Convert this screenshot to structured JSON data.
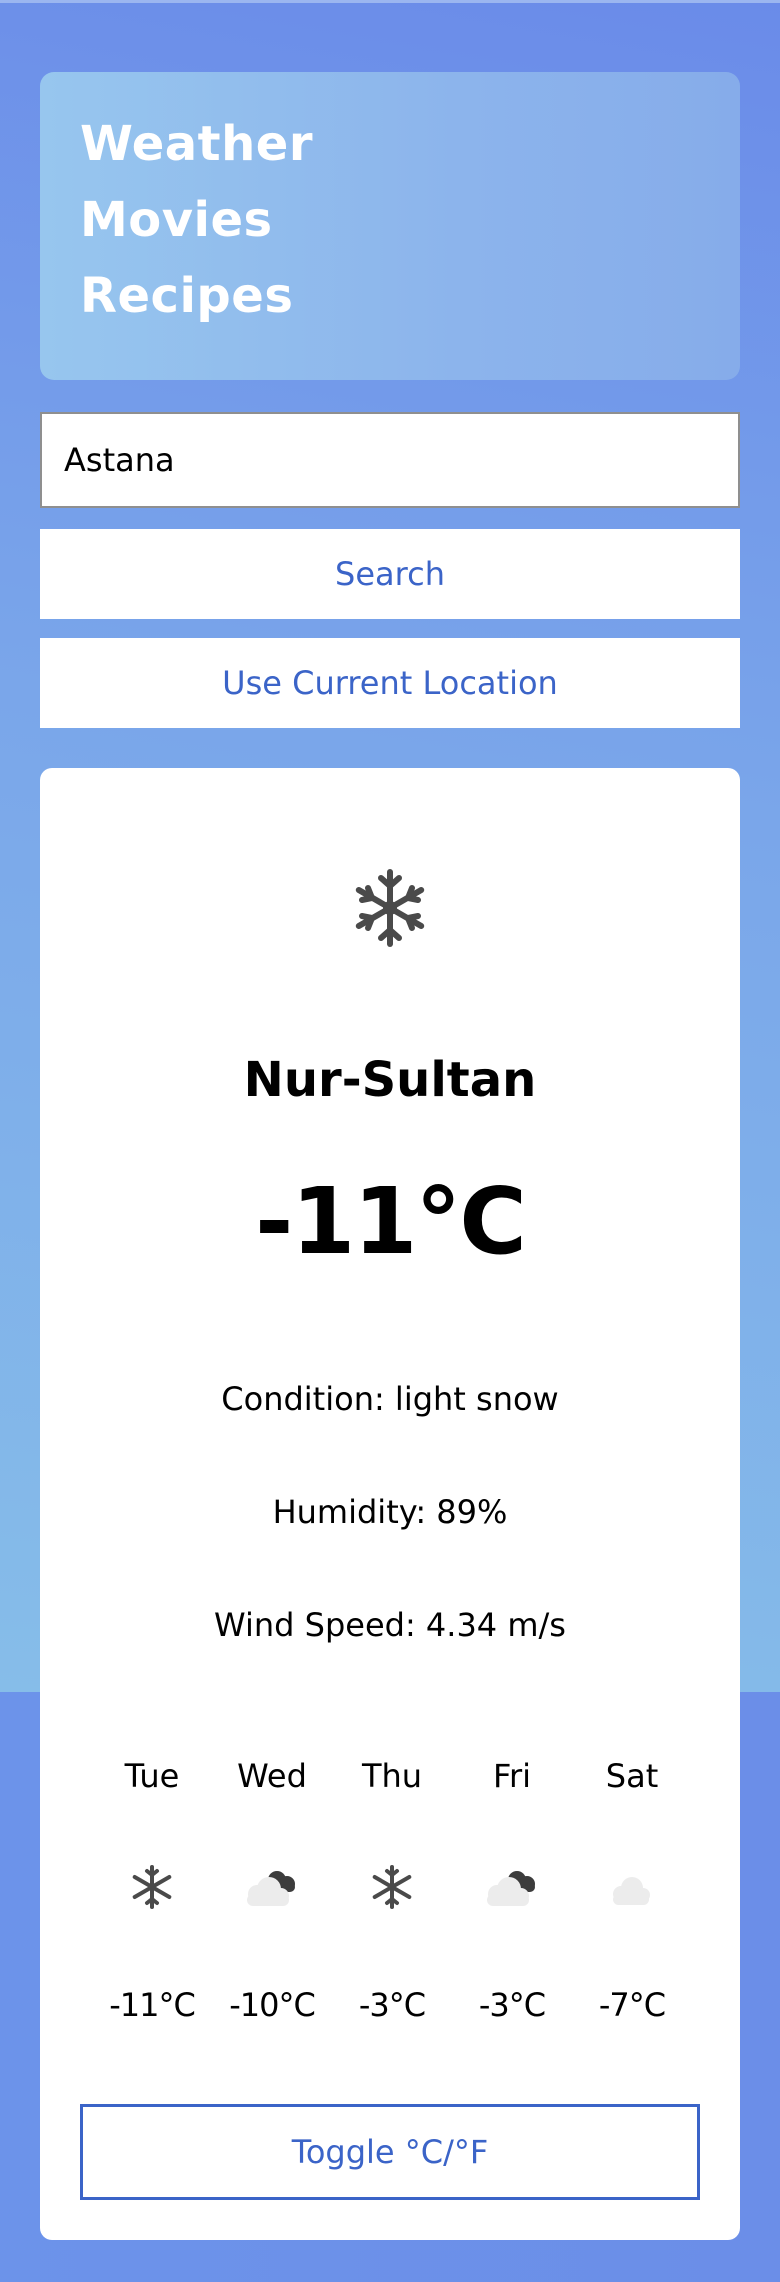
{
  "nav": {
    "weather": "Weather",
    "movies": "Movies",
    "recipes": "Recipes"
  },
  "search": {
    "value": "Astana",
    "button_label": "Search",
    "location_button_label": "Use Current Location"
  },
  "weather": {
    "icon": "snowflake-icon",
    "city": "Nur-Sultan",
    "temperature": "-11°C",
    "condition": "Condition: light snow",
    "humidity": "Humidity: 89%",
    "wind": "Wind Speed: 4.34 m/s"
  },
  "forecast": [
    {
      "day": "Tue",
      "icon": "snowflake-icon",
      "temp": "-11°C"
    },
    {
      "day": "Wed",
      "icon": "cloud-with-dark-cloud-icon",
      "temp": "-10°C"
    },
    {
      "day": "Thu",
      "icon": "snowflake-icon",
      "temp": "-3°C"
    },
    {
      "day": "Fri",
      "icon": "cloud-with-dark-cloud-icon",
      "temp": "-3°C"
    },
    {
      "day": "Sat",
      "icon": "cloud-icon",
      "temp": "-7°C"
    }
  ],
  "toggle_label": "Toggle °C/°F",
  "colors": {
    "accent": "#3b64c8",
    "background": "#6b8ee8",
    "card": "#ffffff"
  }
}
